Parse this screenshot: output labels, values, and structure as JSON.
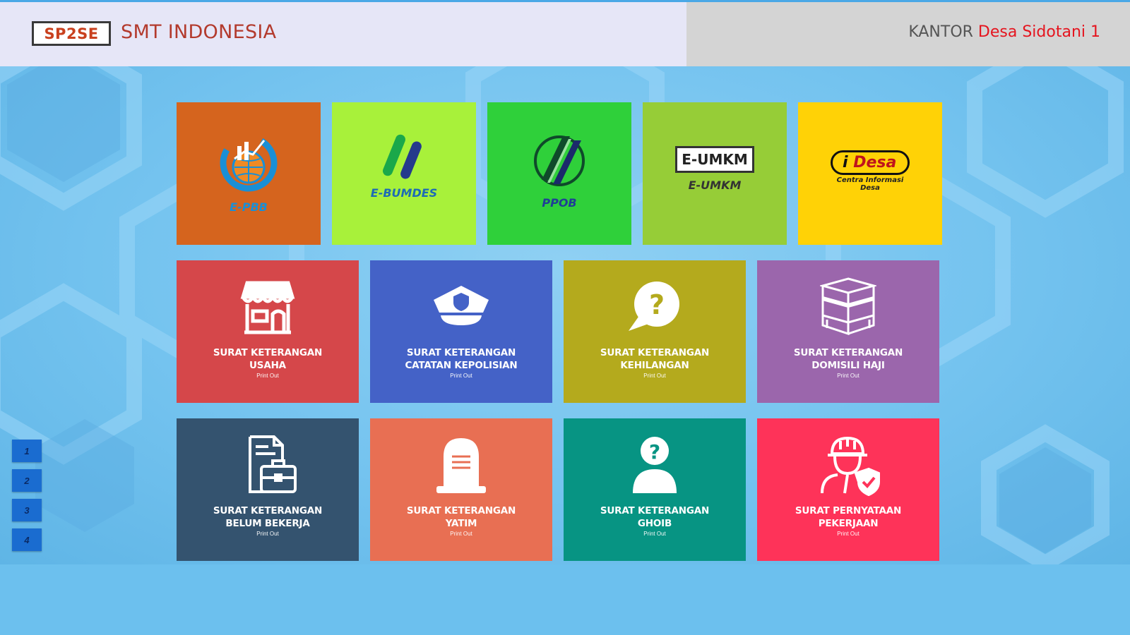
{
  "header": {
    "logo_text": "SP2SE",
    "app_name": "SMT INDONESIA",
    "office_label": "KANTOR",
    "office_name": "Desa Sidotani 1"
  },
  "apps": [
    {
      "label": "E-PBB",
      "icon": "epbb-logo",
      "color": "#d5641e",
      "label_color": "#1a8fd6"
    },
    {
      "label": "E-BUMDES",
      "icon": "ebumdes-logo",
      "color": "#a8f13a",
      "label_color": "#1d6bb5"
    },
    {
      "label": "PPOB",
      "icon": "ppob-logo",
      "color": "#2fd03a",
      "label_color": "#1f3e96"
    },
    {
      "label": "E-UMKM",
      "icon": "eumkm-logo",
      "color": "#96cd37",
      "label_color": "#333333",
      "logo_text": "E-UMKM"
    },
    {
      "label": "",
      "icon": "idesa-logo",
      "color": "#ffd206",
      "logo_text": "Desa",
      "logo_sub": "Centra Informasi Desa"
    }
  ],
  "letters": [
    {
      "line1": "SURAT KETERANGAN",
      "line2": "USAHA",
      "sub": "Print Out",
      "color": "#d5474a",
      "icon": "store-icon"
    },
    {
      "line1": "SURAT KETERANGAN",
      "line2": "CATATAN KEPOLISIAN",
      "sub": "Print Out",
      "color": "#4462c7",
      "icon": "police-cap-icon"
    },
    {
      "line1": "SURAT KETERANGAN",
      "line2": "KEHILANGAN",
      "sub": "Print Out",
      "color": "#b4aa1d",
      "icon": "question-bubble-icon"
    },
    {
      "line1": "SURAT KETERANGAN",
      "line2": "DOMISILI HAJI",
      "sub": "Print Out",
      "color": "#9b66ac",
      "icon": "kaaba-icon"
    },
    {
      "line1": "SURAT KETERANGAN",
      "line2": "BELUM BEKERJA",
      "sub": "Print Out",
      "color": "#34536f",
      "icon": "briefcase-document-icon"
    },
    {
      "line1": "SURAT KETERANGAN",
      "line2": "YATIM",
      "sub": "Print Out",
      "color": "#e86f53",
      "icon": "tombstone-icon"
    },
    {
      "line1": "SURAT KETERANGAN",
      "line2": "GHOIB",
      "sub": "Print Out",
      "color": "#079483",
      "icon": "unknown-person-icon"
    },
    {
      "line1": "SURAT PERNYATAAN",
      "line2": "PEKERJAAN",
      "sub": "Print Out",
      "color": "#fe3359",
      "icon": "worker-icon"
    }
  ],
  "pager": [
    "1",
    "2",
    "3",
    "4"
  ]
}
